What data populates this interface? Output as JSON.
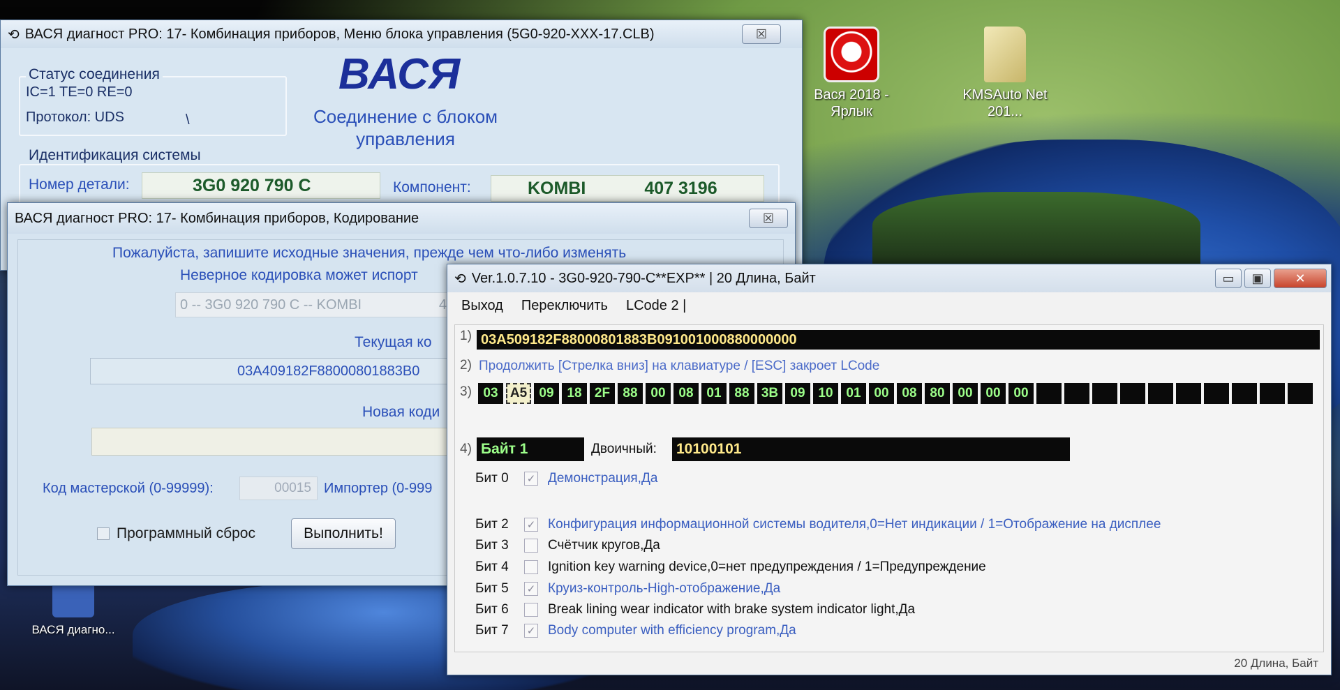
{
  "desktop": {
    "icons": [
      {
        "label": "Вася 2018 - Ярлык",
        "icon": "vasya-app-icon"
      },
      {
        "label": "KMSAuto Net 201...",
        "icon": "folder-icon"
      },
      {
        "label": "ВАСЯ диагно...",
        "icon": "vasya-shortcut-icon"
      }
    ]
  },
  "main_window": {
    "title": "ВАСЯ диагност PRO: 17- Комбинация приборов,  Меню блока управления (5G0-920-XXX-17.CLB)",
    "close_glyph": "☒",
    "status_group": "Статус соединения",
    "status_line": "IC=1  TE=0   RE=0",
    "protocol": "Протокол: UDS",
    "slash": "\\",
    "logo": "ВАСЯ",
    "connection_text": "Соединение с блоком управления",
    "ident_group": "Идентификация системы",
    "part_label": "Номер детали:",
    "part_value": "3G0 920 790 C",
    "component_label": "Компонент:",
    "component_name": "KOMBI",
    "component_code": "407 3196"
  },
  "coding_window": {
    "title": "ВАСЯ диагност PRO: 17- Комбинация приборов,  Кодирование",
    "close_glyph": "☒",
    "note1": "Пожалуйста, запишите исходные значения, прежде чем что-либо изменять",
    "note2": "Неверное кодировка может испорт",
    "combo_value": "0 -- 3G0 920 790 C -- KOMBI",
    "combo_suffix": "4",
    "current_label": "Текущая ко",
    "current_value": "03A409182F88000801883B0",
    "new_label": "Новая коди",
    "workshop_label": "Код мастерской (0-99999):",
    "workshop_value": "00015",
    "importer_label": "Импортер (0-999",
    "soft_reset": "Программный сброс",
    "execute": "Выполнить!"
  },
  "lcode_window": {
    "title": "Ver.1.0.7.10 -    3G0-920-790-C**EXP** | 20 Длина, Байт",
    "min_glyph": "▭",
    "max_glyph": "▣",
    "close_glyph": "✕",
    "menu": [
      "Выход",
      "Переключить",
      "LCode 2 |"
    ],
    "row1_num": "1)",
    "row1_value": "03A509182F88000801883B091001000880000000",
    "row2_num": "2)",
    "row2_text": "Продолжить [Стрелка вниз] на клавиатуре / [ESC] закроет LCode",
    "row3_num": "3)",
    "bytes": [
      "03",
      "A5",
      "09",
      "18",
      "2F",
      "88",
      "00",
      "08",
      "01",
      "88",
      "3B",
      "09",
      "10",
      "01",
      "00",
      "08",
      "80",
      "00",
      "00",
      "00",
      "",
      "",
      "",
      "",
      "",
      "",
      "",
      "",
      "",
      ""
    ],
    "row4_num": "4)",
    "byte_label": "Байт 1",
    "binary_label": "Двоичный:",
    "binary_value": "10100101",
    "bits": [
      {
        "label": "Бит 0",
        "checked": true,
        "text": "Демонстрация,Да",
        "style": "blue"
      },
      {
        "label": "Бит 2",
        "checked": true,
        "text": "Конфигурация информационной системы водителя,0=Нет индикации / 1=Отображение на дисплее",
        "style": "blue"
      },
      {
        "label": "Бит 3",
        "checked": false,
        "text": "Счётчик кругов,Да",
        "style": "black"
      },
      {
        "label": "Бит 4",
        "checked": false,
        "text": "Ignition key warning device,0=нет предупреждения / 1=Предупреждение",
        "style": "black"
      },
      {
        "label": "Бит 5",
        "checked": true,
        "text": "Круиз-контроль-High-отображение,Да",
        "style": "blue"
      },
      {
        "label": "Бит 6",
        "checked": false,
        "text": "Break lining wear indicator with brake system indicator light,Да",
        "style": "black"
      },
      {
        "label": "Бит 7",
        "checked": true,
        "text": "Body computer with efficiency program,Да",
        "style": "blue"
      }
    ],
    "status": "20 Длина, Байт",
    "check_glyph": "✓"
  }
}
